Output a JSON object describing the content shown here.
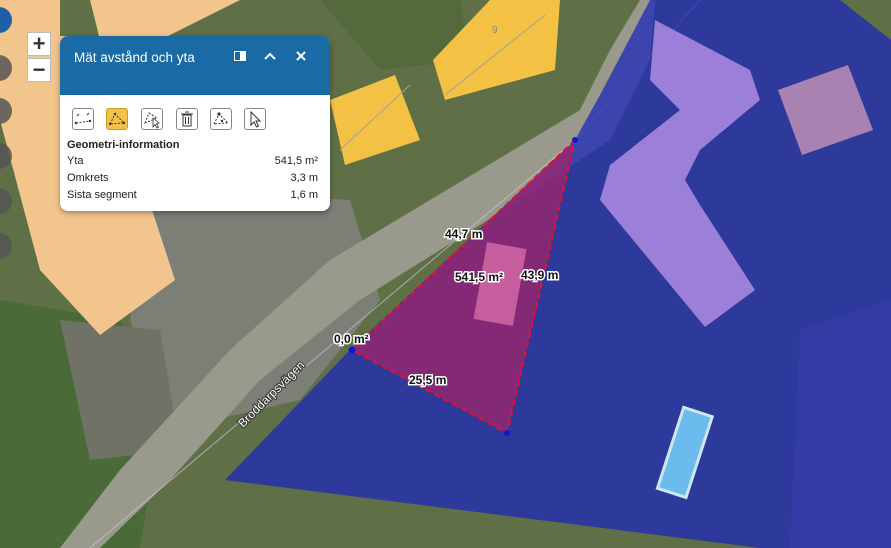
{
  "map": {
    "building_label": "9",
    "road_name": "Broddarpsvägen",
    "measurements": {
      "edge_top": "44,7 m",
      "edge_right": "43,9 m",
      "edge_bottom": "25,5 m",
      "area": "541,5 m²",
      "start_point": "0,0 m²"
    }
  },
  "controls": {
    "zoom_in": "+",
    "zoom_out": "−"
  },
  "panel": {
    "title": "Mät avstånd och yta",
    "tools": [
      "measure-line",
      "measure-polygon",
      "edit-vertices",
      "delete",
      "select-vertex",
      "pointer"
    ],
    "active_tool": "measure-polygon",
    "info_title": "Geometri-information",
    "rows": [
      {
        "label": "Yta",
        "value": "541,5 m²"
      },
      {
        "label": "Omkrets",
        "value": "3,3 m"
      },
      {
        "label": "Sista segment",
        "value": "1,6 m"
      }
    ]
  },
  "colors": {
    "panel_header": "#1a6aa6",
    "polygon_blue": "#1c27b8",
    "measure_fill": "#a0246a",
    "measure_edge": "#e8102a",
    "building_orange": "#f9c98f",
    "building_yellow": "#f3c244",
    "building_purple": "#9b7fd9",
    "active_tool": "#f3c244"
  }
}
